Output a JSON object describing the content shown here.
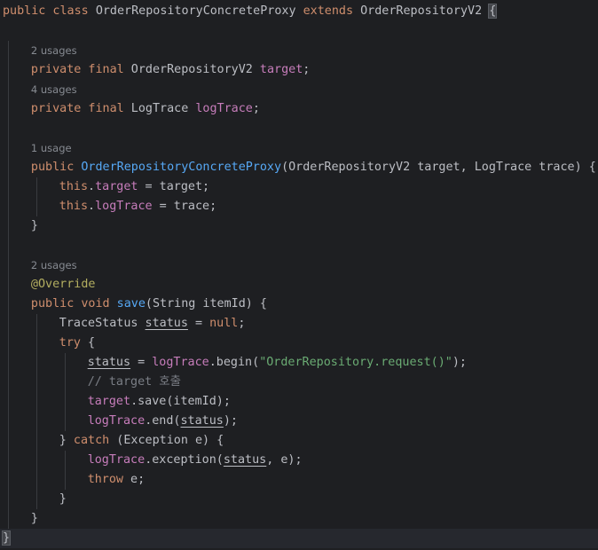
{
  "editor": {
    "lines": [
      {
        "type": "code",
        "indent": 0,
        "tokens": [
          {
            "t": "public class ",
            "c": "kw"
          },
          {
            "t": "OrderRepositoryConcreteProxy ",
            "c": "def"
          },
          {
            "t": "extends ",
            "c": "kw"
          },
          {
            "t": "OrderRepositoryV2 ",
            "c": "def"
          },
          {
            "t": "{",
            "c": "def",
            "hl": true
          }
        ]
      },
      {
        "type": "blank"
      },
      {
        "type": "hint",
        "indent": 1,
        "text": "2 usages"
      },
      {
        "type": "code",
        "indent": 1,
        "tokens": [
          {
            "t": "private final ",
            "c": "kw"
          },
          {
            "t": "OrderRepositoryV2 ",
            "c": "def"
          },
          {
            "t": "target",
            "c": "field"
          },
          {
            "t": ";",
            "c": "def"
          }
        ]
      },
      {
        "type": "hint",
        "indent": 1,
        "text": "4 usages"
      },
      {
        "type": "code",
        "indent": 1,
        "tokens": [
          {
            "t": "private final ",
            "c": "kw"
          },
          {
            "t": "LogTrace ",
            "c": "def"
          },
          {
            "t": "logTrace",
            "c": "field"
          },
          {
            "t": ";",
            "c": "def"
          }
        ]
      },
      {
        "type": "blank"
      },
      {
        "type": "hint",
        "indent": 1,
        "text": "1 usage"
      },
      {
        "type": "code",
        "indent": 1,
        "tokens": [
          {
            "t": "public ",
            "c": "kw"
          },
          {
            "t": "OrderRepositoryConcreteProxy",
            "c": "decl"
          },
          {
            "t": "(OrderRepositoryV2 target, LogTrace trace) {",
            "c": "def"
          }
        ]
      },
      {
        "type": "code",
        "indent": 2,
        "tokens": [
          {
            "t": "this",
            "c": "kw"
          },
          {
            "t": ".",
            "c": "def"
          },
          {
            "t": "target",
            "c": "field"
          },
          {
            "t": " = target;",
            "c": "def"
          }
        ]
      },
      {
        "type": "code",
        "indent": 2,
        "tokens": [
          {
            "t": "this",
            "c": "kw"
          },
          {
            "t": ".",
            "c": "def"
          },
          {
            "t": "logTrace",
            "c": "field"
          },
          {
            "t": " = trace;",
            "c": "def"
          }
        ]
      },
      {
        "type": "code",
        "indent": 1,
        "tokens": [
          {
            "t": "}",
            "c": "def"
          }
        ]
      },
      {
        "type": "blank"
      },
      {
        "type": "hint",
        "indent": 1,
        "text": "2 usages"
      },
      {
        "type": "code",
        "indent": 1,
        "tokens": [
          {
            "t": "@Override",
            "c": "ann"
          }
        ]
      },
      {
        "type": "code",
        "indent": 1,
        "tokens": [
          {
            "t": "public void ",
            "c": "kw"
          },
          {
            "t": "save",
            "c": "decl"
          },
          {
            "t": "(String itemId) {",
            "c": "def"
          }
        ]
      },
      {
        "type": "code",
        "indent": 2,
        "tokens": [
          {
            "t": "TraceStatus ",
            "c": "def"
          },
          {
            "t": "status",
            "c": "def",
            "ul": true
          },
          {
            "t": " = ",
            "c": "def"
          },
          {
            "t": "null",
            "c": "kw"
          },
          {
            "t": ";",
            "c": "def"
          }
        ]
      },
      {
        "type": "code",
        "indent": 2,
        "tokens": [
          {
            "t": "try",
            "c": "kw"
          },
          {
            "t": " {",
            "c": "def"
          }
        ]
      },
      {
        "type": "code",
        "indent": 3,
        "tokens": [
          {
            "t": "status",
            "c": "def",
            "ul": true
          },
          {
            "t": " = ",
            "c": "def"
          },
          {
            "t": "logTrace",
            "c": "field"
          },
          {
            "t": ".begin(",
            "c": "def"
          },
          {
            "t": "\"OrderRepository.request()\"",
            "c": "str"
          },
          {
            "t": ");",
            "c": "def"
          }
        ]
      },
      {
        "type": "code",
        "indent": 3,
        "tokens": [
          {
            "t": "// target 호출",
            "c": "cmt"
          }
        ]
      },
      {
        "type": "code",
        "indent": 3,
        "tokens": [
          {
            "t": "target",
            "c": "field"
          },
          {
            "t": ".save(itemId);",
            "c": "def"
          }
        ]
      },
      {
        "type": "code",
        "indent": 3,
        "tokens": [
          {
            "t": "logTrace",
            "c": "field"
          },
          {
            "t": ".end(",
            "c": "def"
          },
          {
            "t": "status",
            "c": "def",
            "ul": true
          },
          {
            "t": ");",
            "c": "def"
          }
        ]
      },
      {
        "type": "code",
        "indent": 2,
        "tokens": [
          {
            "t": "} ",
            "c": "def"
          },
          {
            "t": "catch",
            "c": "kw"
          },
          {
            "t": " (Exception e) {",
            "c": "def"
          }
        ]
      },
      {
        "type": "code",
        "indent": 3,
        "tokens": [
          {
            "t": "logTrace",
            "c": "field"
          },
          {
            "t": ".exception(",
            "c": "def"
          },
          {
            "t": "status",
            "c": "def",
            "ul": true
          },
          {
            "t": ", e);",
            "c": "def"
          }
        ]
      },
      {
        "type": "code",
        "indent": 3,
        "tokens": [
          {
            "t": "throw",
            "c": "kw"
          },
          {
            "t": " e;",
            "c": "def"
          }
        ]
      },
      {
        "type": "code",
        "indent": 2,
        "tokens": [
          {
            "t": "}",
            "c": "def"
          }
        ]
      },
      {
        "type": "code",
        "indent": 1,
        "tokens": [
          {
            "t": "}",
            "c": "def"
          }
        ]
      },
      {
        "type": "code",
        "indent": 0,
        "current": true,
        "tokens": [
          {
            "t": "}",
            "c": "def",
            "hl": true
          }
        ]
      }
    ]
  }
}
